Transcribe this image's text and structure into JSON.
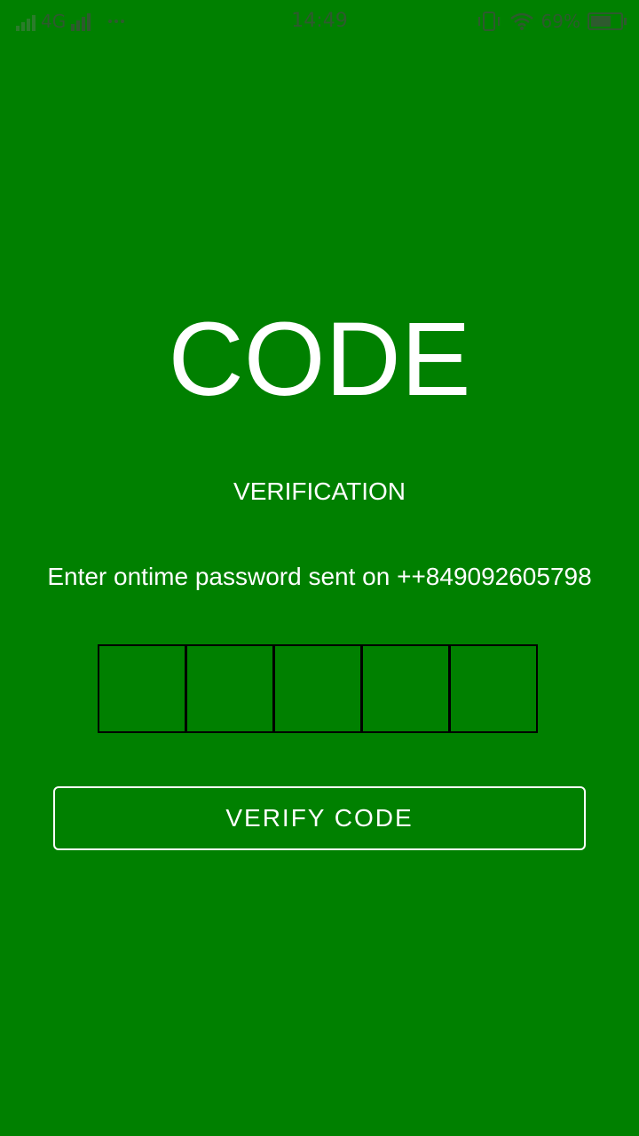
{
  "theme": {
    "background": "#008000",
    "text_color": "#ffffff",
    "box_border": "#000000",
    "status_bar_color": "#2e5a2e"
  },
  "status_bar": {
    "network_type": "4G",
    "time": "14:49",
    "battery_percent_label": "69%",
    "battery_level": 0.69,
    "icons": [
      "signal-icon",
      "signal-icon",
      "more-dots-icon",
      "vibrate-icon",
      "wifi-icon",
      "battery-icon"
    ]
  },
  "verification": {
    "title": "CODE",
    "subtitle": "VERIFICATION",
    "instruction": "Enter ontime password sent on ++849092605798",
    "otp_values": [
      "",
      "",
      "",
      "",
      ""
    ],
    "verify_label": "VERIFY CODE"
  }
}
